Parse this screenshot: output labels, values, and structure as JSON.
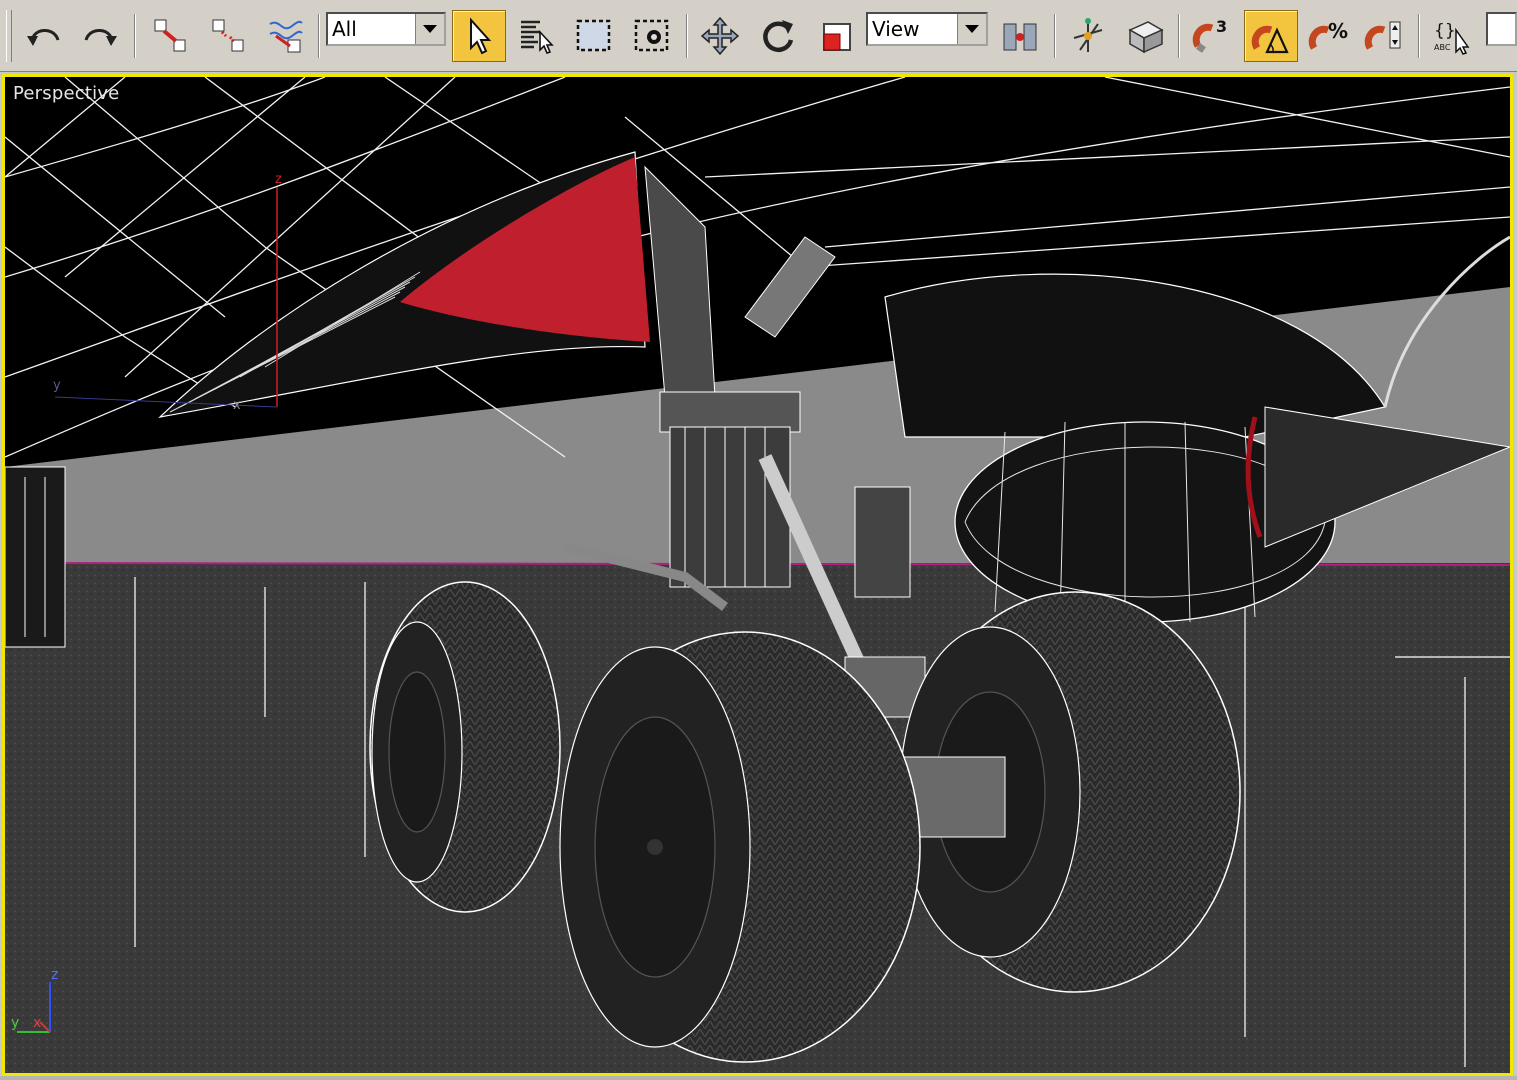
{
  "toolbar": {
    "buttons": [
      {
        "id": "undo",
        "label": "Undo"
      },
      {
        "id": "redo",
        "label": "Redo"
      },
      {
        "id": "select-and-link",
        "label": "Select and Link"
      },
      {
        "id": "unlink-selection",
        "label": "Unlink Selection"
      },
      {
        "id": "bind-to-space-warp",
        "label": "Bind to Space Warp"
      },
      {
        "id": "select-object",
        "label": "Select Object"
      },
      {
        "id": "select-by-name",
        "label": "Select by Name"
      },
      {
        "id": "rectangular-selection-region",
        "label": "Rectangular Selection Region"
      },
      {
        "id": "window-crossing",
        "label": "Window/Crossing"
      },
      {
        "id": "select-and-move",
        "label": "Select and Move"
      },
      {
        "id": "select-and-rotate",
        "label": "Select and Rotate"
      },
      {
        "id": "select-and-scale",
        "label": "Select and Scale"
      },
      {
        "id": "use-pivot-point-center",
        "label": "Use Pivot Point Center"
      },
      {
        "id": "select-and-manipulate",
        "label": "Select and Manipulate"
      },
      {
        "id": "keyboard-shortcut-override",
        "label": "Keyboard Shortcut Override"
      },
      {
        "id": "snaps-toggle",
        "label": "3D Snaps Toggle"
      },
      {
        "id": "angle-snap-toggle",
        "label": "Angle Snap Toggle"
      },
      {
        "id": "percent-snap-toggle",
        "label": "Percent Snap Toggle"
      },
      {
        "id": "spinner-snap-toggle",
        "label": "Spinner Snap Toggle"
      },
      {
        "id": "edit-named-selection-sets",
        "label": "Edit Named Selection Sets"
      }
    ],
    "selection_filter": "All",
    "reference_coordinate_system": "View",
    "snap_number": "3",
    "percent_symbol": "%",
    "named_sets_glyph": "{}",
    "named_sets_caption": "ABC",
    "accent_active": "#f3c53f"
  },
  "viewport": {
    "label": "Perspective",
    "border_color": "#f0e800",
    "gizmo_axis_z": "z",
    "gizmo_axis_y": "y",
    "gizmo_axis_x": "x",
    "world_axis_z": "z",
    "world_axis_y": "y",
    "world_axis_x": "x"
  }
}
